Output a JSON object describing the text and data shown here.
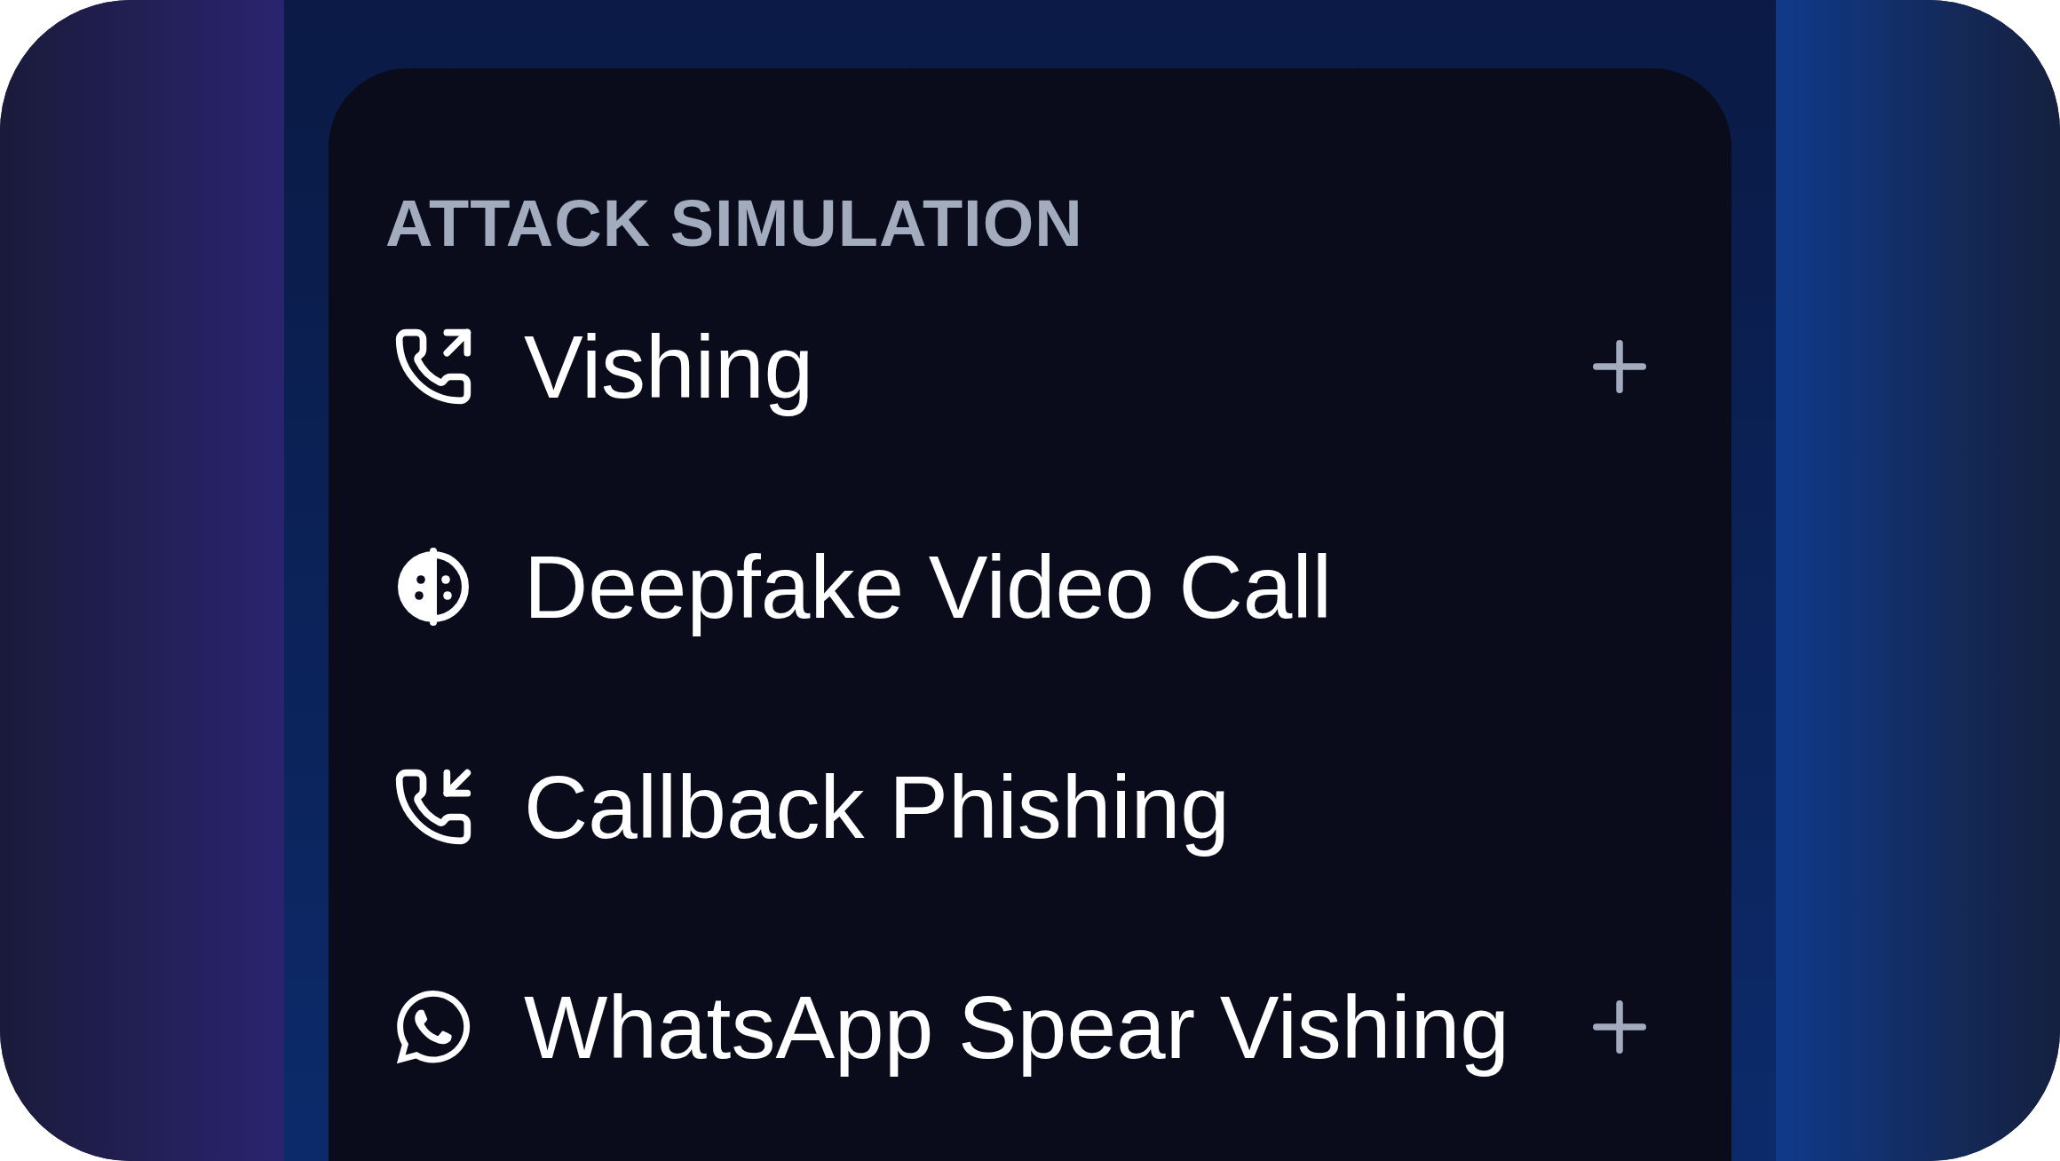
{
  "section": {
    "title": "ATTACK SIMULATION"
  },
  "items": [
    {
      "label": "Vishing",
      "addable": true
    },
    {
      "label": "Deepfake Video Call",
      "addable": false
    },
    {
      "label": "Callback Phishing",
      "addable": false
    },
    {
      "label": "WhatsApp Spear Vishing",
      "addable": true
    }
  ]
}
